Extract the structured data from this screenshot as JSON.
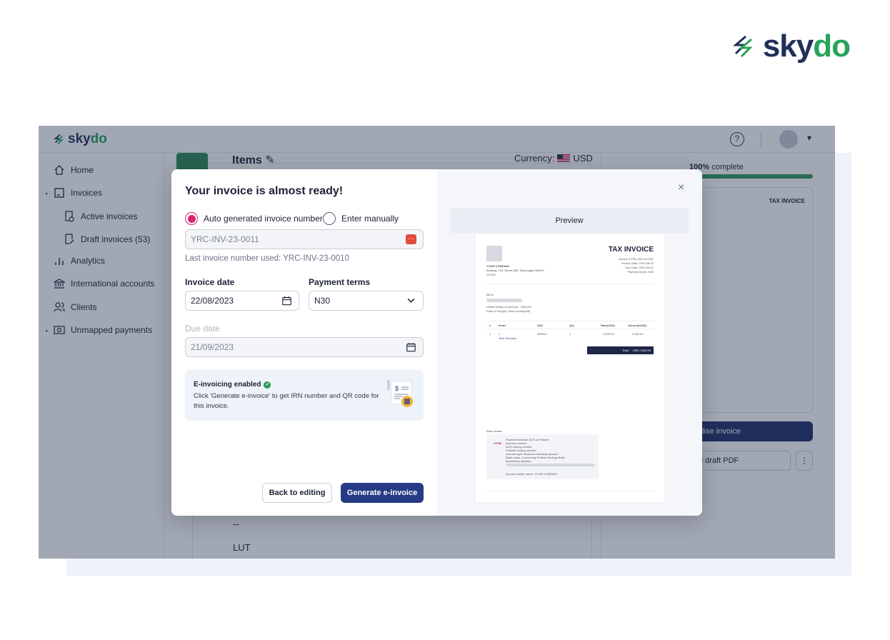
{
  "brand": {
    "name_main": "sky",
    "name_accent": "do"
  },
  "app": {
    "logo_main": "sky",
    "logo_accent": "do",
    "help_icon": "?",
    "sidebar": {
      "items": [
        {
          "label": "Home",
          "icon": "home-icon"
        },
        {
          "label": "Invoices",
          "icon": "invoice-icon"
        },
        {
          "label": "Active invoices",
          "icon": "active-invoice-icon"
        },
        {
          "label": "Draft invoices (53)",
          "icon": "draft-invoice-icon"
        },
        {
          "label": "Analytics",
          "icon": "analytics-icon"
        },
        {
          "label": "International accounts",
          "icon": "bank-icon"
        },
        {
          "label": "Clients",
          "icon": "clients-icon"
        },
        {
          "label": "Unmapped payments",
          "icon": "payments-icon"
        }
      ]
    },
    "main": {
      "items_title": "Items",
      "currency_label": "Currency:",
      "currency_code": "USD",
      "dash": "--",
      "lut": "LUT"
    },
    "right": {
      "complete_pct_text": "100%",
      "complete_text": " complete",
      "complete_fraction": 1.0,
      "mini_title": "TAX INVOICE",
      "finalise_label": "alise invoice",
      "draft_pdf_label": "d draft PDF",
      "more_label": "⋮"
    }
  },
  "modal": {
    "title": "Your invoice is almost ready!",
    "radio_auto": "Auto generated invoice number",
    "radio_manual": "Enter manually",
    "invoice_number": "YRC-INV-23-0011",
    "last_used": "Last invoice number used: YRC-INV-23-0010",
    "invoice_date_label": "Invoice date",
    "invoice_date": "22/08/2023",
    "payment_terms_label": "Payment terms",
    "payment_terms": "N30",
    "due_date_label": "Due date",
    "due_date": "21/09/2023",
    "einvoice_title": "E-invoicing enabled",
    "einvoice_desc": "Click 'Generate e-invoice' to get IRN number and QR code for this invoice.",
    "back_button": "Back to editing",
    "generate_button": "Generate e-invoice",
    "close": "×",
    "preview_label": "Preview",
    "preview_doc": {
      "title": "TAX INVOICE",
      "company": "YOUR COMPANY",
      "address": "Building: 123, Street ABC, Bhavnagar,364001",
      "gstin": "GSTIN:",
      "meta": [
        "Invoice #:YRC-INV-23-0011",
        "Invoice Date: 2023-08-22",
        "Due Date: 2023-09-21",
        "Payment terms: N30"
      ],
      "bill_to": "Bill to",
      "country": "United States of America - 3232202",
      "place_supply": "Place of Supply: Other country(96)",
      "table_headers": [
        "#",
        "Items",
        "SAC",
        "Qty",
        "Rate(USD)",
        "Amount(USD)"
      ],
      "row": [
        "1",
        "1",
        "998314",
        "1",
        "2,000.00",
        "2,000.00"
      ],
      "row_sub": "Tech Services",
      "total_label": "Total",
      "total_value": "USD 2,000.00",
      "bank_title": "Bank details",
      "bank_lines": [
        "Payment method: ACH or Fedwire",
        "Account number:",
        "ACH routing number:",
        "Fedwire routing number:",
        "Account type: Business checking account",
        "Bank name: Community Federal Savings Bank",
        "Beneficiary address:",
        "",
        "Account holder name: YOUR COMPANY"
      ]
    }
  }
}
